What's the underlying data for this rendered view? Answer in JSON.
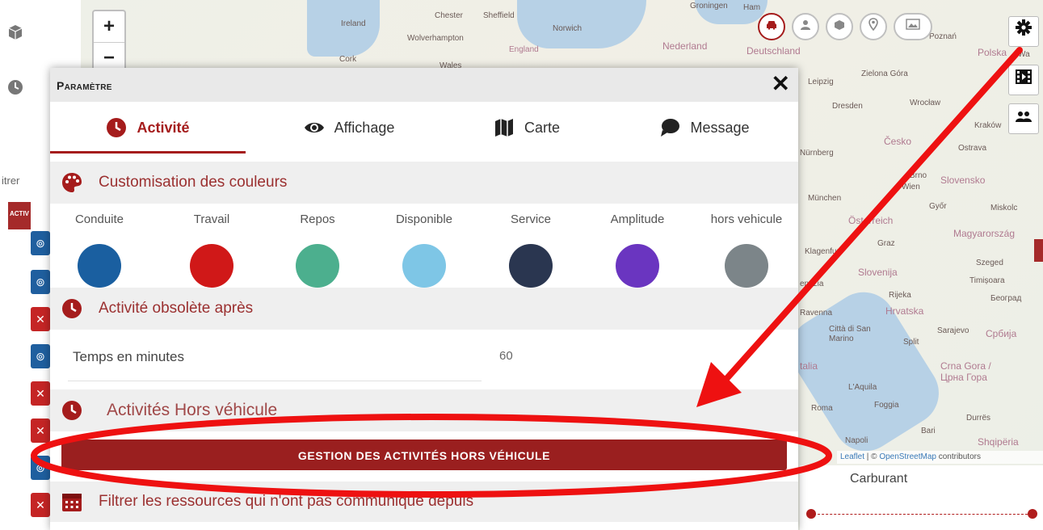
{
  "map": {
    "labels": {
      "ireland": "Ireland",
      "cork": "Cork",
      "wales": "Wales",
      "chester": "Chester",
      "sheffield": "Sheffield",
      "wolverhampton": "Wolverhampton",
      "england": "England",
      "norwich": "Norwich",
      "nederland": "Nederland",
      "deutschland": "Deutschland",
      "groningen": "Groningen",
      "hamburg": "Ham",
      "leipzig": "Leipzig",
      "dresden": "Dresden",
      "wroclaw": "Wrocław",
      "zielona_gora": "Zielona Góra",
      "poznan": "Poznań",
      "polska": "Polska",
      "warsaw": "Wa",
      "cesko": "Česko",
      "krakow": "Kraków",
      "ostrava": "Ostrava",
      "nurnberg": "Nürnberg",
      "munchen": "München",
      "wien": "Wien",
      "brno": "Brno",
      "slovensko": "Slovensko",
      "gyor": "Győr",
      "miskolc": "Miskolc",
      "osterreich": "Österreich",
      "magyarorszag": "Magyarország",
      "graz": "Graz",
      "klagenfurt": "Klagenfurt",
      "slovenija": "Slovenija",
      "szeged": "Szeged",
      "timisoara": "Timișoara",
      "rijeka": "Rijeka",
      "beograd": "Београд",
      "hrvatska": "Hrvatska",
      "ravenna": "Ravenna",
      "sarajevo": "Sarajevo",
      "srbija": "Србија",
      "san_marino": "Città di San Marino",
      "split": "Split",
      "crna_gora": "Crna Gora / Црна Гора",
      "laquila": "L'Aquila",
      "roma": "Roma",
      "foggia": "Foggia",
      "durres": "Durrës",
      "napoli": "Napoli",
      "bari": "Bari",
      "shqiperia": "Shqipëria",
      "italia": "talia",
      "venezia": "enezia"
    },
    "zoom_in": "+",
    "zoom_out": "−",
    "attribution": {
      "leaflet": "Leaflet",
      "separator": " | © ",
      "osm": "OpenStreetMap",
      "contrib": " contributors"
    }
  },
  "left_strip": {
    "filter_text": "itrer",
    "column_header": "ACTIV"
  },
  "modal": {
    "title": "Paramètre",
    "close": "✕",
    "tabs": [
      {
        "label": "Activité"
      },
      {
        "label": "Affichage"
      },
      {
        "label": "Carte"
      },
      {
        "label": "Message"
      }
    ],
    "sections": {
      "colors": "Customisation des couleurs",
      "obsolete": "Activité obsolète après",
      "offvehicle": "Activités Hors véhicule",
      "filter": "Filtrer les ressources qui n'ont pas communiqué depuis"
    },
    "color_items": [
      {
        "label": "Conduite",
        "color": "#1a5fa0"
      },
      {
        "label": "Travail",
        "color": "#d01818"
      },
      {
        "label": "Repos",
        "color": "#4caf8e"
      },
      {
        "label": "Disponible",
        "color": "#7ec6e6"
      },
      {
        "label": "Service",
        "color": "#2a3650"
      },
      {
        "label": "Amplitude",
        "color": "#6a35c0"
      },
      {
        "label": "hors vehicule",
        "color": "#7c8589"
      }
    ],
    "minutes": {
      "label": "Temps en minutes",
      "value": "60"
    },
    "offvehicle_button": "GESTION DES ACTIVITÉS HORS VÉHICULE"
  },
  "fuel_panel": {
    "label": "Carburant"
  },
  "colors": {
    "accent": "#a51c1c",
    "annotation": "#ee1111"
  },
  "icons": {
    "top_bar": [
      "car-icon",
      "user-icon",
      "box-icon",
      "map-pin-icon",
      "image-icon",
      "gear-icon"
    ]
  }
}
